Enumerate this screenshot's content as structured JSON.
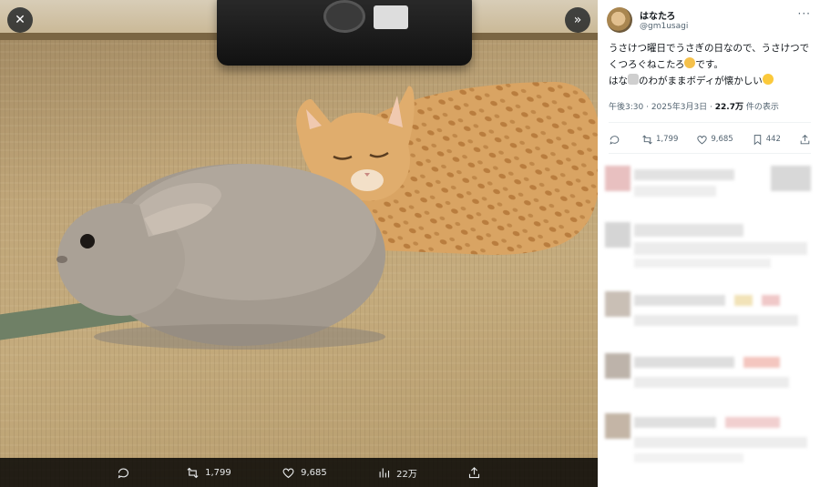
{
  "media": {
    "close_icon": "close-icon",
    "expand_icon": "chevron-double-right-icon",
    "close_symbol": "✕",
    "expand_symbol": "»"
  },
  "media_actions": {
    "reply_count": "",
    "retweet_count": "1,799",
    "like_count": "9,685",
    "view_count": "22万",
    "share_icon": "share-icon"
  },
  "user": {
    "display_name": "はなたろ",
    "handle": "@gm1usagi",
    "more_symbol": "···"
  },
  "tweet": {
    "line1": "うさけつ曜日でうさぎの日なので、うさけつでくつろぐねこたろ",
    "line1_tail": "です。",
    "line2_head": "はな",
    "line2_tail": "のわがままボディが懐かしい",
    "emojis": [
      "smiling-cat-emoji",
      "rabbit-emoji",
      "laughing-emoji"
    ]
  },
  "meta": {
    "time": "午後3:30",
    "sep": " · ",
    "date": "2025年3月3日",
    "views_num": "22.7万",
    "views_label": " 件の表示"
  },
  "stats": {
    "reply": "",
    "retweet": "1,799",
    "like": "9,685",
    "bookmark": "442"
  },
  "colors": {
    "text_primary": "#0f1419",
    "text_secondary": "#536471",
    "media_bar": "#000000"
  }
}
